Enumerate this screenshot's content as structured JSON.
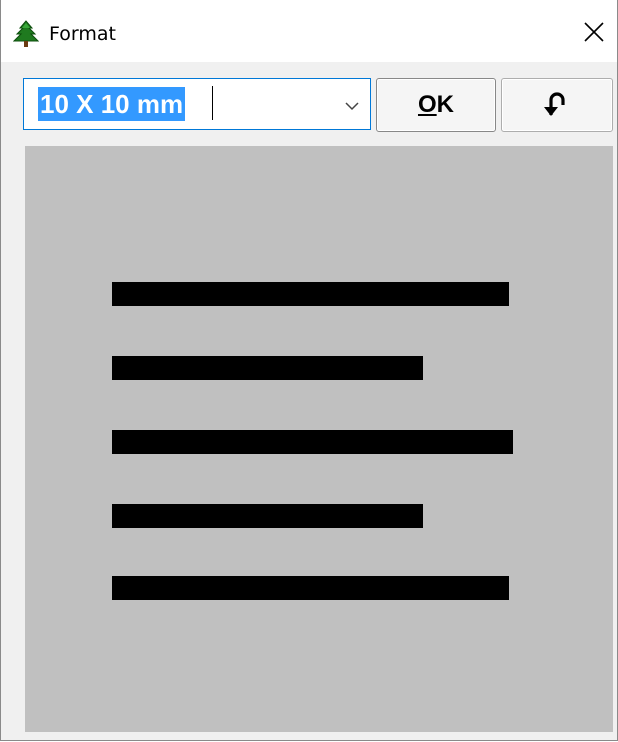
{
  "window": {
    "title": "Format",
    "icon": "tree-icon",
    "close_icon": "close-icon"
  },
  "toolbar": {
    "size_combo": {
      "value": "10 X 10 mm",
      "selected": true,
      "dropdown_icon": "chevron-down-icon"
    },
    "ok_button": {
      "label": "OK",
      "mnemonic": "O"
    },
    "undo_button": {
      "icon": "undo-arrow-icon"
    }
  },
  "preview": {
    "background": "#c0c0c0",
    "line_color": "#000000",
    "lines": 5
  }
}
